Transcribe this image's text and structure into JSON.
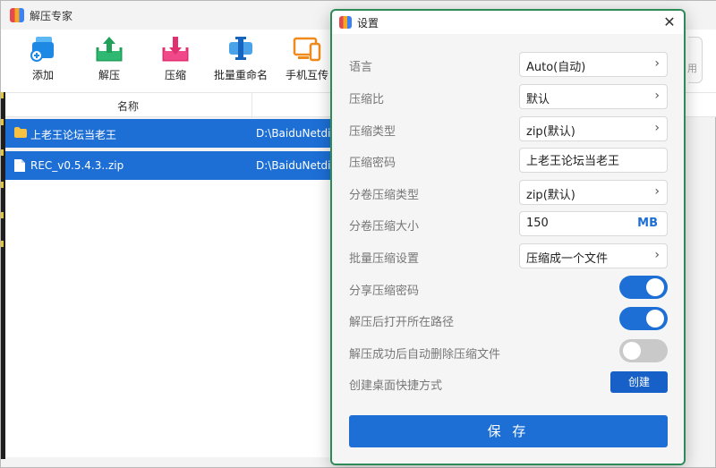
{
  "app": {
    "title": "解压专家"
  },
  "toolbar": {
    "items": [
      {
        "label": "添加",
        "icon": "add-files-icon"
      },
      {
        "label": "解压",
        "icon": "extract-icon"
      },
      {
        "label": "压缩",
        "icon": "compress-icon"
      },
      {
        "label": "批量重命名",
        "icon": "batch-rename-icon"
      },
      {
        "label": "手机互传",
        "icon": "phone-transfer-icon"
      }
    ]
  },
  "list": {
    "header_name": "名称",
    "rows": [
      {
        "name": "上老王论坛当老王",
        "path": "D:\\BaiduNetdisk",
        "icon": "folder-icon"
      },
      {
        "name": "REC_v0.5.4.3..zip",
        "path": "D:\\BaiduNetdisk",
        "icon": "file-icon"
      }
    ]
  },
  "right_partial_text": "用",
  "settings": {
    "title": "设置",
    "close_icon": "close-icon",
    "rows": [
      {
        "label": "语言",
        "value": "Auto(自动)"
      },
      {
        "label": "压缩比",
        "value": "默认"
      },
      {
        "label": "压缩类型",
        "value": "zip(默认)"
      },
      {
        "label": "压缩密码",
        "value": "上老王论坛当老王"
      },
      {
        "label": "分卷压缩类型",
        "value": "zip(默认)"
      },
      {
        "label": "分卷压缩大小",
        "value": "150",
        "unit": "MB"
      },
      {
        "label": "批量压缩设置",
        "value": "压缩成一个文件"
      },
      {
        "label": "分享压缩密码",
        "toggle": true
      },
      {
        "label": "解压后打开所在路径",
        "toggle": true
      },
      {
        "label": "解压成功后自动删除压缩文件",
        "toggle": false
      },
      {
        "label": "创建桌面快捷方式",
        "button": "创建"
      }
    ],
    "save_label": "保 存"
  },
  "colors": {
    "accent": "#1d6fd6",
    "dialog_border": "#2e8b57",
    "selection": "#1d6fd6"
  }
}
